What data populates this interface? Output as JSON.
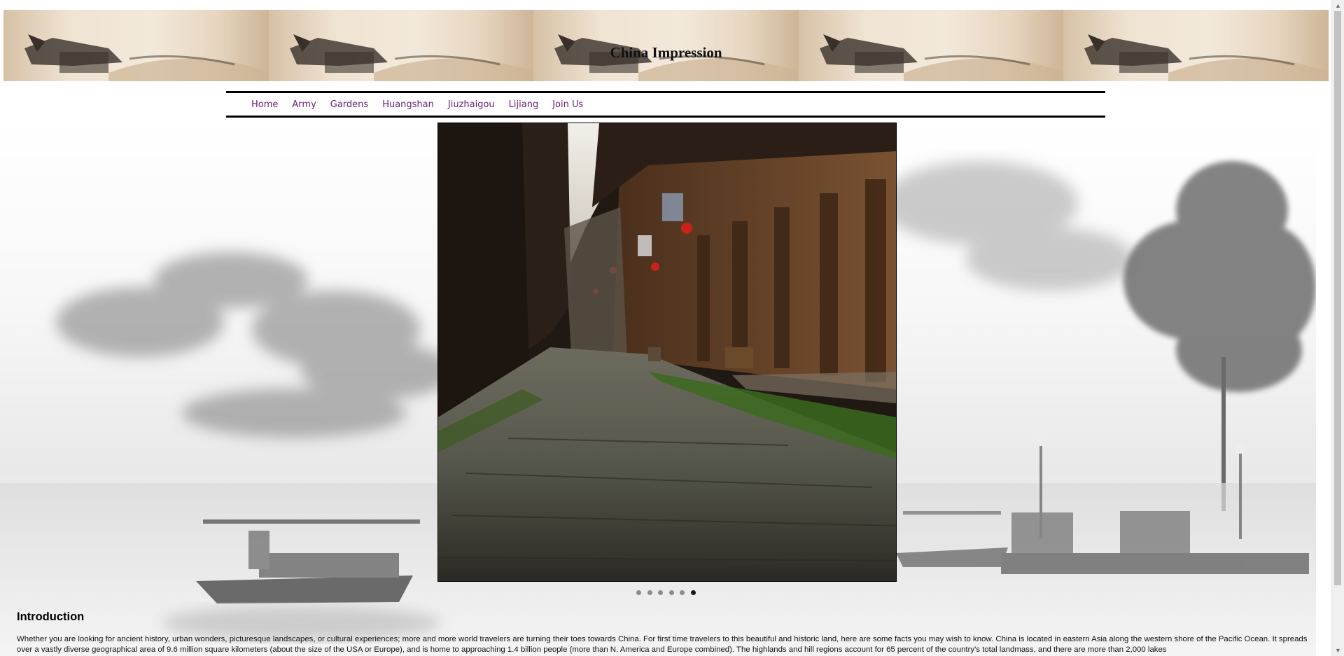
{
  "header": {
    "title": "China Impression"
  },
  "nav": {
    "items": [
      {
        "label": "Home"
      },
      {
        "label": "Army"
      },
      {
        "label": "Gardens"
      },
      {
        "label": "Huangshan"
      },
      {
        "label": "Jiuzhaigou"
      },
      {
        "label": "Lijiang"
      },
      {
        "label": "Join Us"
      }
    ]
  },
  "slideshow": {
    "slide_count": 6,
    "active_index": 6
  },
  "intro": {
    "heading": "Introduction",
    "text": "Whether you are looking for ancient history, urban wonders, picturesque landscapes, or cultural experiences; more and more world travelers are turning their toes towards China. For first time travelers to this beautiful and historic land, here are some facts you may wish to know. China is located in eastern Asia along the western shore of the Pacific Ocean. It spreads over a vastly diverse geographical area of 9.6 million square kilometers (about the size of the USA or Europe), and is home to approaching 1.4 billion people (more than N. America and Europe combined). The highlands and hill regions account for 65 percent of the country's total landmass, and there are more than 2,000 lakes"
  },
  "colors": {
    "nav_link": "#6a1b7a",
    "dot_inactive": "#8c8c8c",
    "dot_active": "#1a1a1a"
  }
}
